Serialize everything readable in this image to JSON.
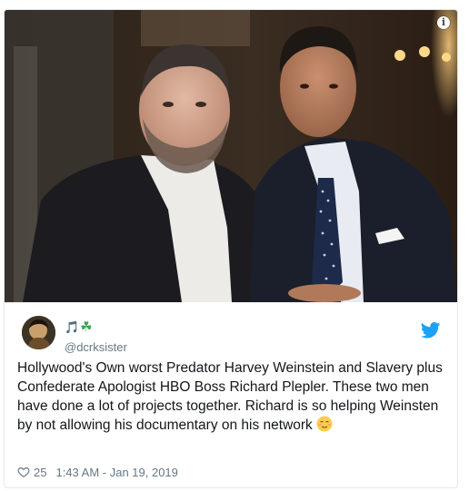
{
  "tweet": {
    "user": {
      "display_name": "🎵",
      "display_name_extra": "☘",
      "handle": "@dcrksister"
    },
    "text": "Hollywood's Own worst Predator Harvey Weinstein and Slavery plus Confederate Apologist HBO Boss Richard Plepler. These two men have done a lot of projects together. Richard is so helping Weinsten by not allowing his documentary on his network",
    "emoji_icon": "relieved-face-emoji",
    "likes": "25",
    "timestamp": "1:43 AM - Jan 19, 2019",
    "info_glyph": "i"
  },
  "colors": {
    "twitter_blue": "#1da1f2",
    "text": "#14171a",
    "muted": "#657786",
    "border": "#e1e8ed"
  },
  "icons": {
    "info": "info-icon",
    "bird": "twitter-bird-icon",
    "heart": "heart-outline-icon",
    "shamrock": "shamrock-icon"
  }
}
